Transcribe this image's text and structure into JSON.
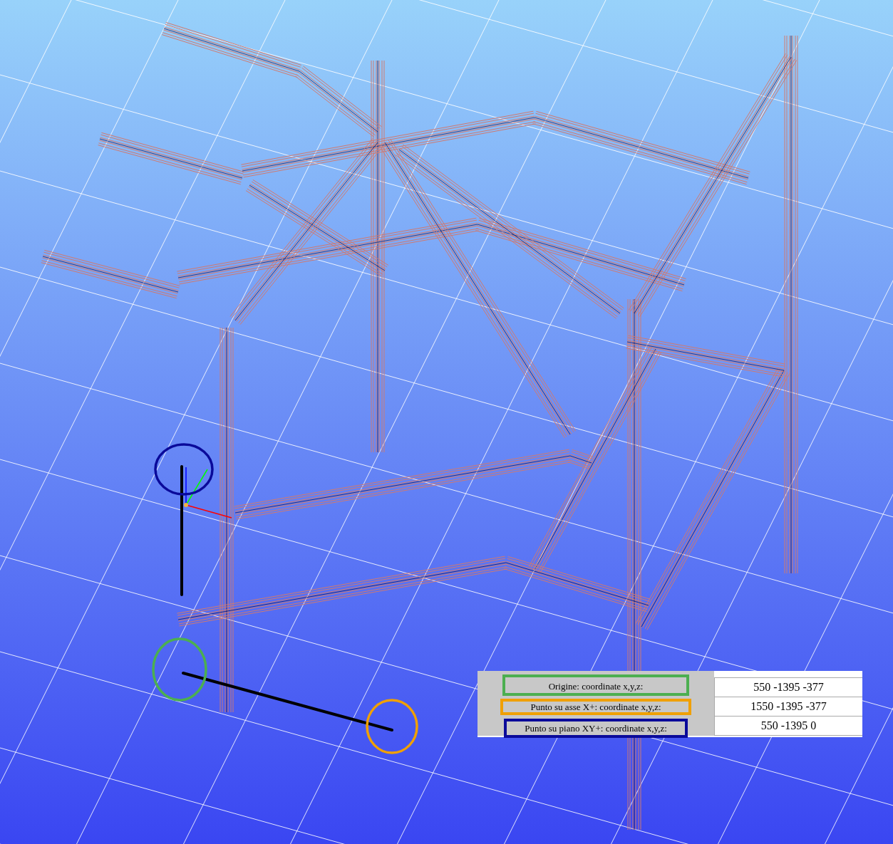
{
  "coordinate_table": {
    "rows": [
      {
        "label": "Origine: coordinate x,y,z:",
        "value": "550 -1395 -377",
        "color": "#4caf50"
      },
      {
        "label": "Punto su asse X+: coordinate x,y,z:",
        "value": "1550 -1395 -377",
        "color": "#f0a000"
      },
      {
        "label": "Punto su piano XY+: coordinate x,y,z:",
        "value": "550 -1395 0",
        "color": "#0a0a9a"
      }
    ]
  }
}
